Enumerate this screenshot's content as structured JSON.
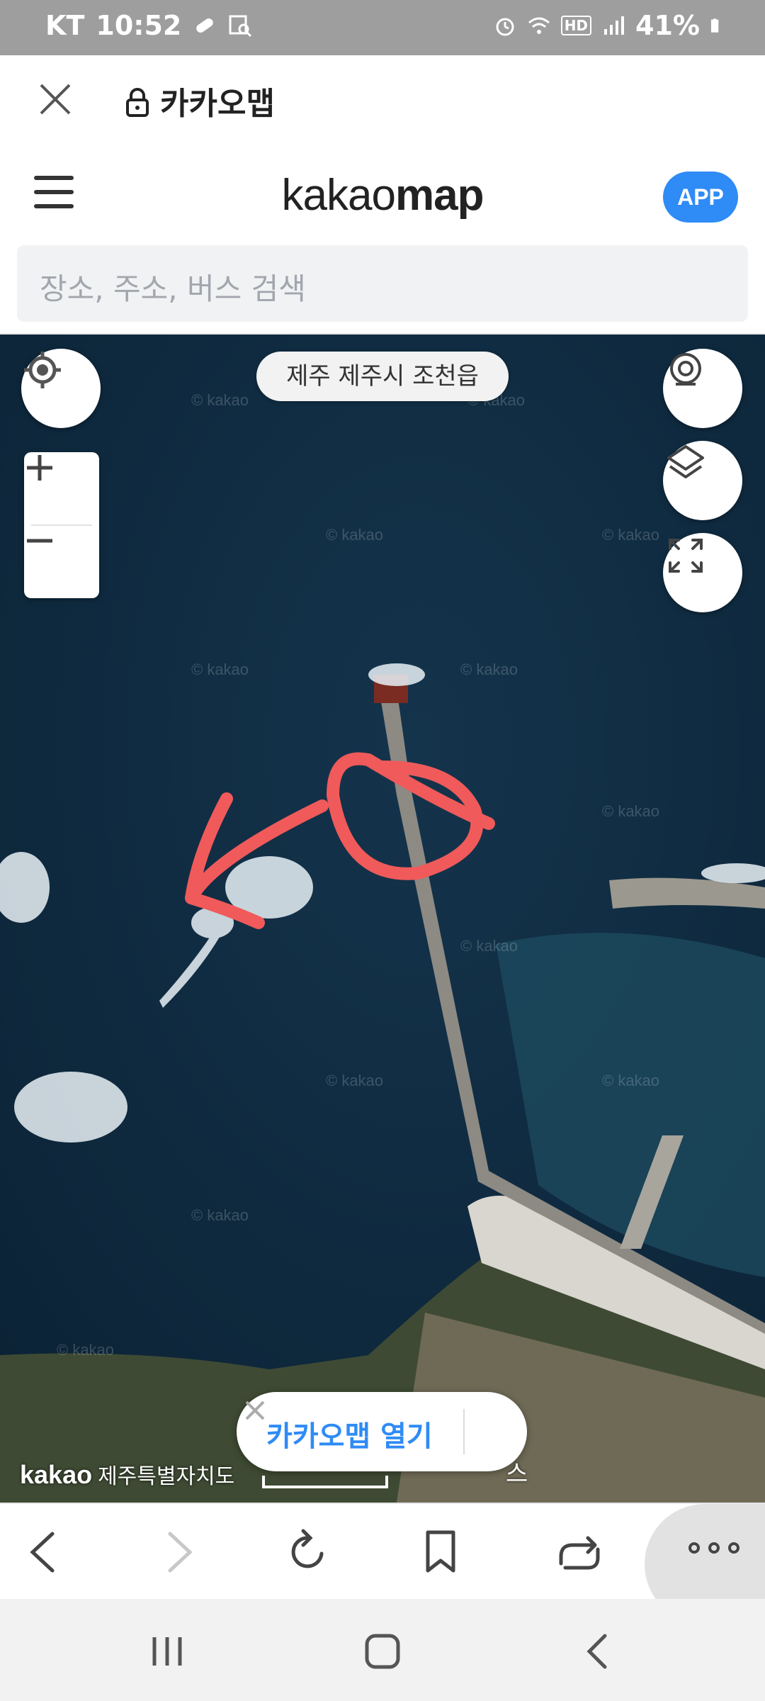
{
  "status_bar": {
    "carrier": "KT",
    "time": "10:52",
    "battery": "41%",
    "hd_label": "HD"
  },
  "browser": {
    "title": "카카오맵"
  },
  "header": {
    "logo_light": "kakao",
    "logo_bold": "map",
    "app_button": "APP"
  },
  "search": {
    "placeholder": "장소, 주소, 버스 검색"
  },
  "map": {
    "location_label": "제주 제주시 조천읍",
    "open_app_label": "카카오맵 열기",
    "attribution_brand": "kakao",
    "attribution_region": "제주특별자치도",
    "attribution_tail": "스",
    "watermark": "© kakao"
  },
  "icons": {
    "close": "close-icon",
    "lock": "lock-icon",
    "menu": "hamburger-icon",
    "locate": "current-location-icon",
    "zoom_in": "plus-icon",
    "zoom_out": "minus-icon",
    "roadview": "roadview-icon",
    "layers": "layers-icon",
    "fullscreen": "fullscreen-icon",
    "back": "back-icon",
    "forward": "forward-icon",
    "reload": "reload-icon",
    "bookmark": "bookmark-icon",
    "share": "share-icon",
    "more": "more-icon"
  },
  "colors": {
    "accent": "#2f8bf5",
    "annotation": "#f05a5a",
    "sea": "#0f2a3f"
  }
}
